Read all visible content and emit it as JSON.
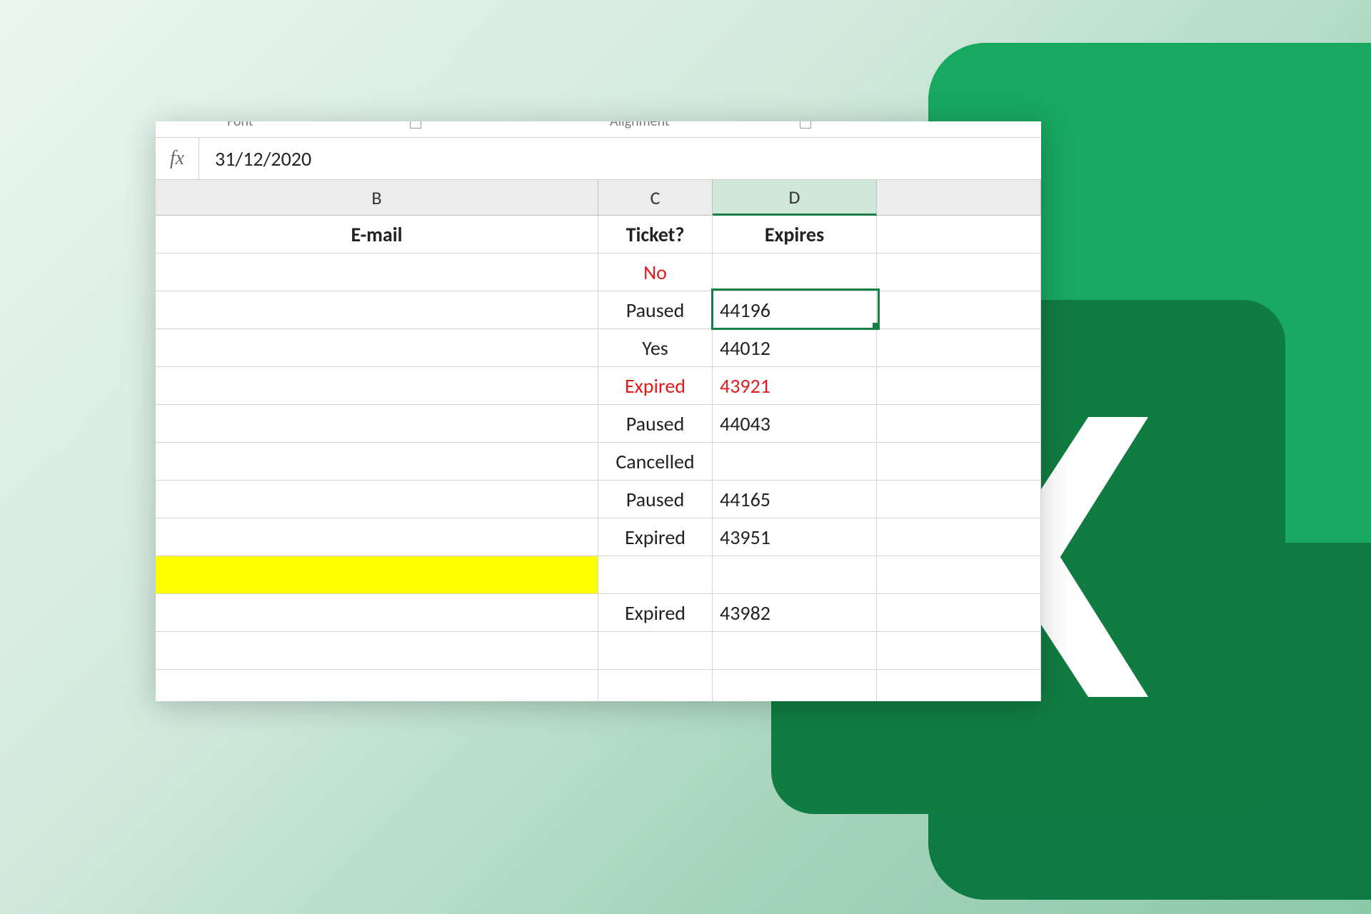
{
  "ribbon": {
    "group_font": "Font",
    "group_alignment": "Alignment"
  },
  "formula_bar": {
    "fx": "fx",
    "value": "31/12/2020"
  },
  "columns": {
    "B": "B",
    "C": "C",
    "D": "D"
  },
  "headers": {
    "email": "E-mail",
    "ticket": "Ticket?",
    "expires": "Expires"
  },
  "rows": [
    {
      "email": "",
      "ticket": "No",
      "ticket_red": true,
      "expires": "",
      "expires_red": false,
      "highlight": false
    },
    {
      "email": "",
      "ticket": "Paused",
      "ticket_red": false,
      "expires": "44196",
      "expires_red": false,
      "highlight": false,
      "active": true
    },
    {
      "email": "",
      "ticket": "Yes",
      "ticket_red": false,
      "expires": "44012",
      "expires_red": false,
      "highlight": false
    },
    {
      "email": "",
      "ticket": "Expired",
      "ticket_red": true,
      "expires": "43921",
      "expires_red": true,
      "highlight": false
    },
    {
      "email": "",
      "ticket": "Paused",
      "ticket_red": false,
      "expires": "44043",
      "expires_red": false,
      "highlight": false
    },
    {
      "email": "",
      "ticket": "Cancelled",
      "ticket_red": false,
      "expires": "",
      "expires_red": false,
      "highlight": false
    },
    {
      "email": "",
      "ticket": "Paused",
      "ticket_red": false,
      "expires": "44165",
      "expires_red": false,
      "highlight": false
    },
    {
      "email": "",
      "ticket": "Expired",
      "ticket_red": false,
      "expires": "43951",
      "expires_red": false,
      "highlight": false
    },
    {
      "email": "",
      "ticket": "",
      "ticket_red": false,
      "expires": "",
      "expires_red": false,
      "highlight": true
    },
    {
      "email": "",
      "ticket": "Expired",
      "ticket_red": false,
      "expires": "43982",
      "expires_red": false,
      "highlight": false
    },
    {
      "email": "",
      "ticket": "",
      "ticket_red": false,
      "expires": "",
      "expires_red": false,
      "highlight": false
    },
    {
      "email": "",
      "ticket": "",
      "ticket_red": false,
      "expires": "",
      "expires_red": false,
      "highlight": false
    }
  ],
  "selected_column": "D",
  "active_cell": {
    "col": "D",
    "row_index": 1
  }
}
